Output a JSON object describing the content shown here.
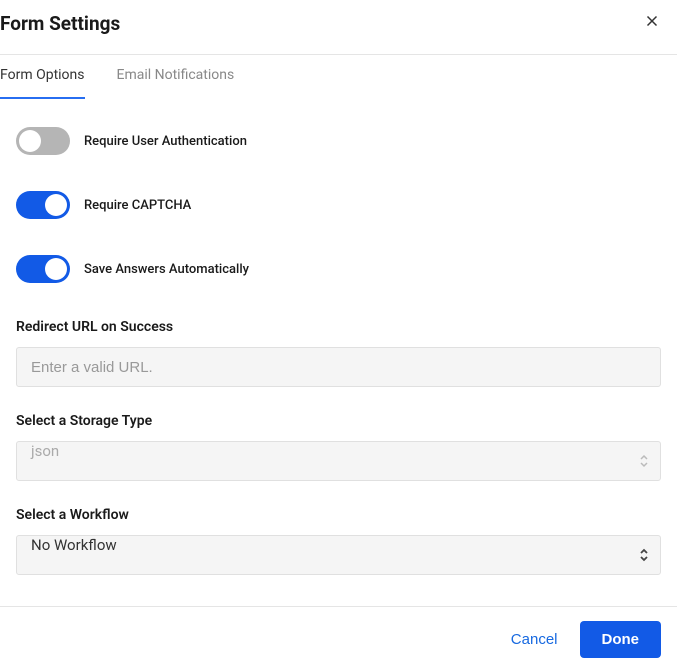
{
  "header": {
    "title": "Form Settings"
  },
  "tabs": {
    "options": "Form Options",
    "notifications": "Email Notifications"
  },
  "toggles": {
    "auth": {
      "label": "Require User Authentication",
      "on": false
    },
    "captcha": {
      "label": "Require CAPTCHA",
      "on": true
    },
    "autosave": {
      "label": "Save Answers Automatically",
      "on": true
    }
  },
  "fields": {
    "redirect": {
      "label": "Redirect URL on Success",
      "placeholder": "Enter a valid URL.",
      "value": ""
    },
    "storage": {
      "label": "Select a Storage Type",
      "value": "json"
    },
    "workflow": {
      "label": "Select a Workflow",
      "value": "No Workflow"
    }
  },
  "footer": {
    "cancel": "Cancel",
    "done": "Done"
  }
}
